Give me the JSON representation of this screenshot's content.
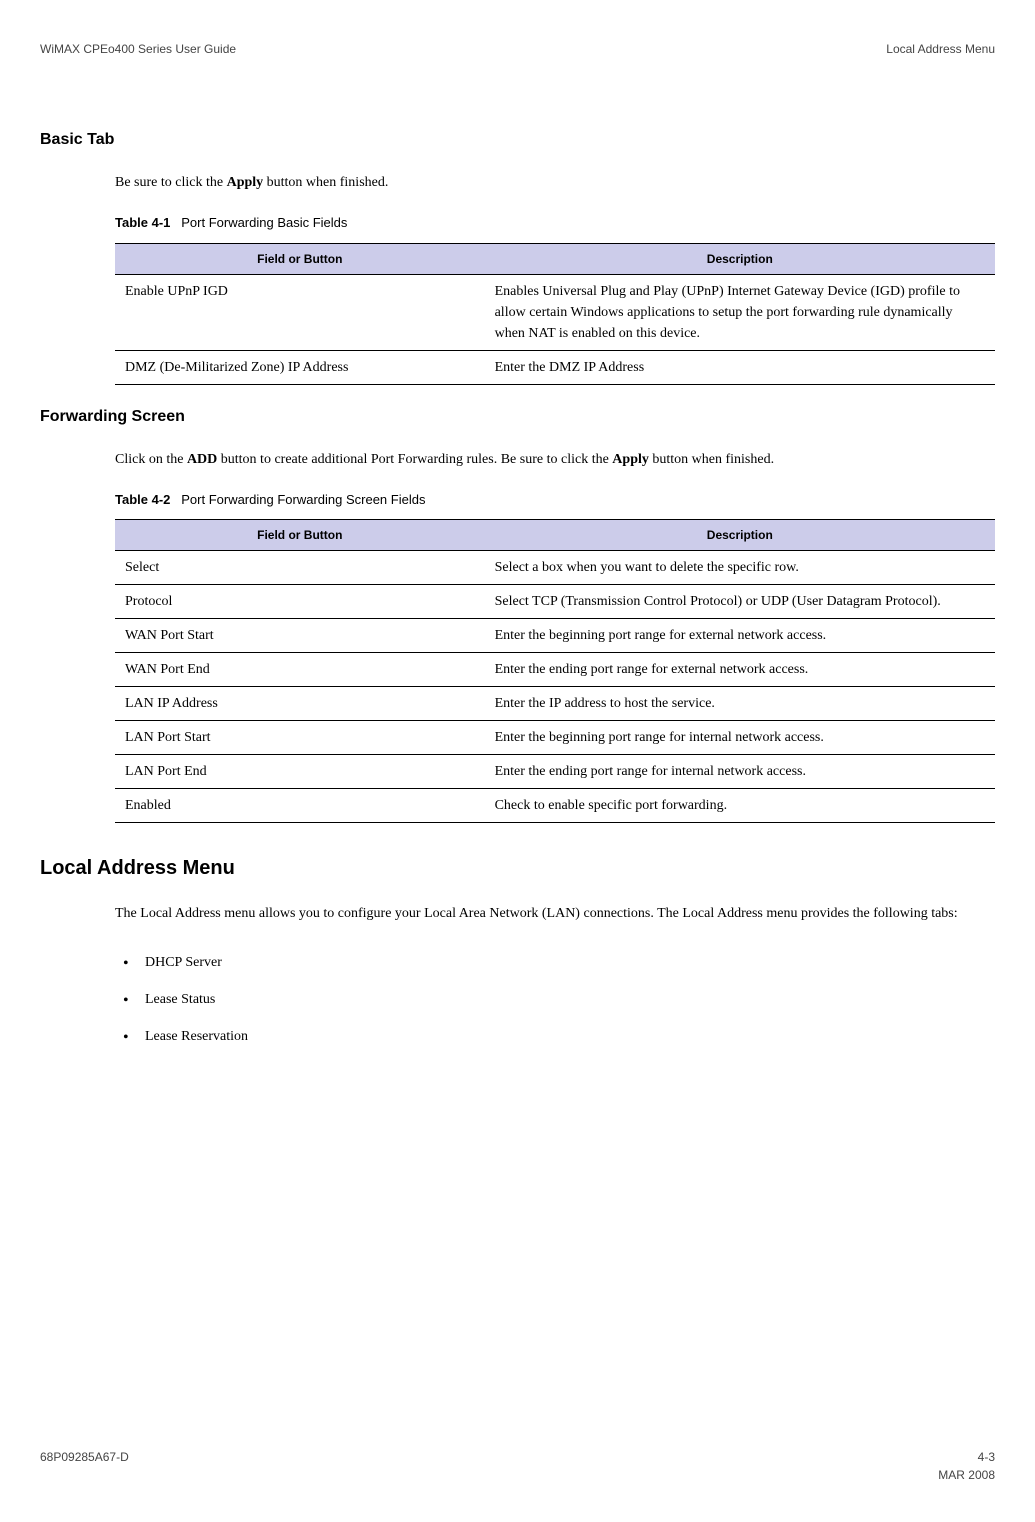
{
  "header": {
    "left": "WiMAX CPEo400 Series User Guide",
    "right": "Local Address Menu"
  },
  "basic_tab": {
    "heading": "Basic Tab",
    "intro_pre": "Be sure to click the ",
    "intro_bold": "Apply",
    "intro_post": " button when finished.",
    "table_label": "Table 4-1",
    "table_title": "Port Forwarding Basic Fields",
    "col1": "Field or Button",
    "col2": "Description",
    "rows": [
      {
        "field": "Enable UPnP IGD",
        "desc": "Enables Universal Plug and Play (UPnP) Internet Gateway Device (IGD) profile to allow certain Windows applications to setup the port forwarding rule dynamically when NAT is enabled on this device."
      },
      {
        "field": "DMZ (De-Militarized Zone) IP Address",
        "desc": "Enter the DMZ IP Address"
      }
    ]
  },
  "forwarding_screen": {
    "heading": "Forwarding Screen",
    "intro_pre": "Click on the ",
    "intro_bold1": "ADD",
    "intro_mid": " button to create additional Port Forwarding rules. Be sure to click the ",
    "intro_bold2": "Apply",
    "intro_post": " button when finished.",
    "table_label": "Table 4-2",
    "table_title": "Port Forwarding Forwarding Screen Fields",
    "col1": "Field or Button",
    "col2": "Description",
    "rows": [
      {
        "field": "Select",
        "desc": "Select a box when you want to delete the specific row."
      },
      {
        "field": "Protocol",
        "desc": "Select TCP (Transmission Control Protocol) or UDP (User Datagram Protocol)."
      },
      {
        "field": "WAN Port Start",
        "desc": "Enter the beginning port range for external network access."
      },
      {
        "field": "WAN Port End",
        "desc": "Enter the ending port range for external network access."
      },
      {
        "field": "LAN IP Address",
        "desc": "Enter the IP address to host the service."
      },
      {
        "field": "LAN Port Start",
        "desc": "Enter the beginning port range for internal network access."
      },
      {
        "field": "LAN Port End",
        "desc": "Enter the ending port range for internal network access."
      },
      {
        "field": "Enabled",
        "desc": "Check to enable specific port forwarding."
      }
    ]
  },
  "local_address": {
    "heading": "Local Address Menu",
    "intro": "The Local Address menu allows you to configure your Local Area Network (LAN) connections. The Local Address menu provides the following tabs:",
    "items": [
      "DHCP Server",
      "Lease Status",
      "Lease Reservation"
    ]
  },
  "footer": {
    "left": "68P09285A67-D",
    "right_top": "4-3",
    "right_bottom": "MAR 2008"
  }
}
